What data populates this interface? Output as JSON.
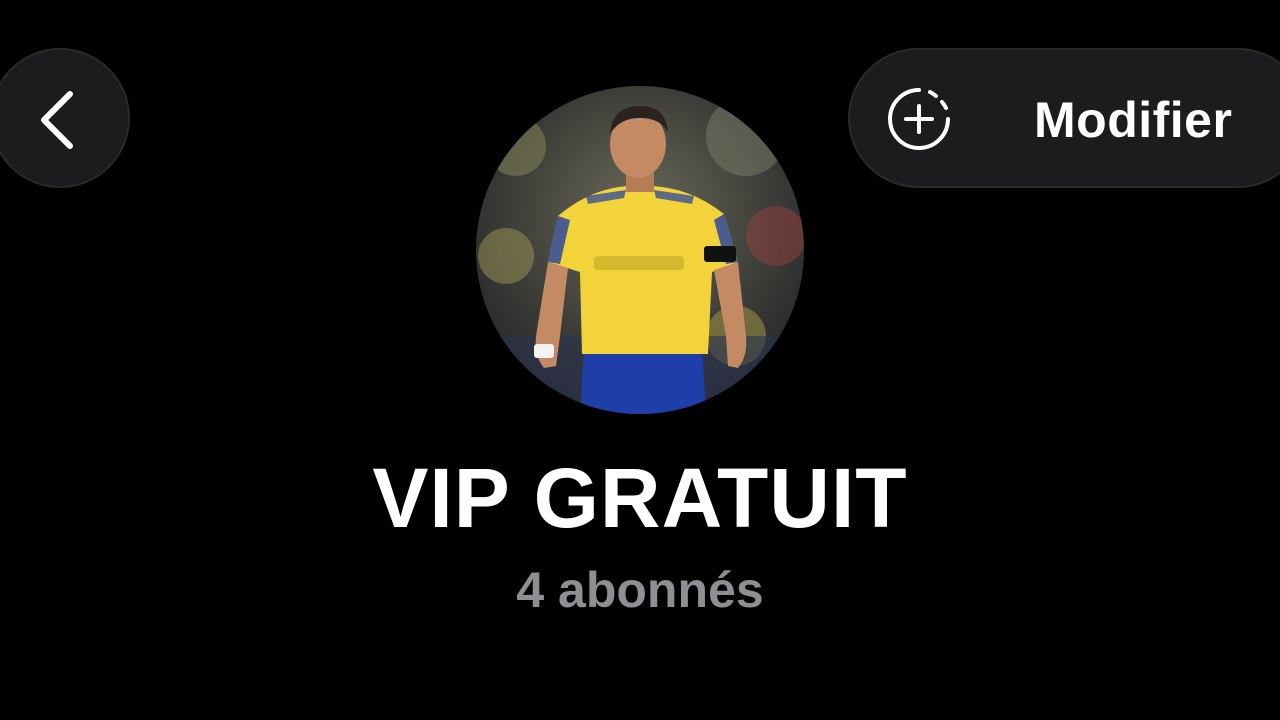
{
  "header": {
    "back_icon": "chevron-left-icon",
    "edit": {
      "icon": "add-story-icon",
      "label": "Modifier"
    }
  },
  "profile": {
    "avatar_description": "profile-photo",
    "title": "VIP GRATUIT",
    "subscribers": "4 abonnés"
  },
  "colors": {
    "background": "#000000",
    "button_bg": "#1c1c1e",
    "title_text": "#ffffff",
    "subtitle_text": "#8e8e93",
    "jersey_yellow": "#f2d43a",
    "shorts_blue": "#1f3ea8"
  }
}
